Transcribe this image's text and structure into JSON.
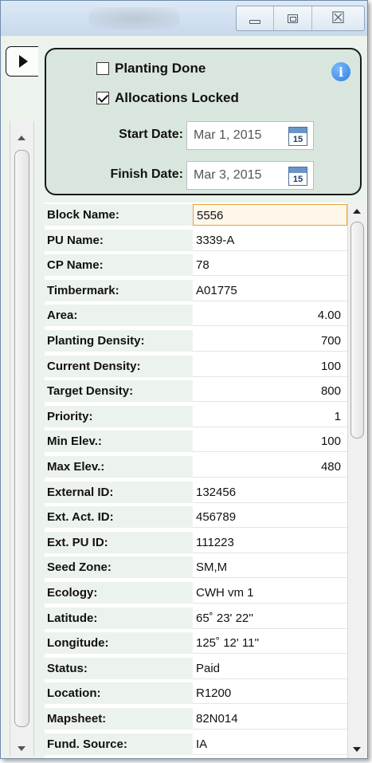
{
  "window": {
    "controls": {
      "minimize_icon": "minimize-icon",
      "maximize_icon": "restore-icon",
      "close_icon": "close-icon",
      "close_glyph": "☒"
    }
  },
  "panel": {
    "planting_done_label": "Planting Done",
    "planting_done_checked": false,
    "allocations_locked_label": "Allocations Locked",
    "allocations_locked_checked": true,
    "info_glyph": "i",
    "start_date_label": "Start Date:",
    "start_date_value": "Mar 1, 2015",
    "finish_date_label": "Finish Date:",
    "finish_date_value": "Mar 3, 2015",
    "calendar_day": "15"
  },
  "grid": {
    "rows": [
      {
        "label": "Block Name:",
        "value": "5556",
        "numeric": false,
        "selected": true
      },
      {
        "label": "PU Name:",
        "value": "3339-A",
        "numeric": false
      },
      {
        "label": "CP Name:",
        "value": "78",
        "numeric": false
      },
      {
        "label": "Timbermark:",
        "value": "A01775",
        "numeric": false
      },
      {
        "label": "Area:",
        "value": "4.00",
        "numeric": true
      },
      {
        "label": "Planting Density:",
        "value": "700",
        "numeric": true
      },
      {
        "label": "Current Density:",
        "value": "100",
        "numeric": true
      },
      {
        "label": "Target Density:",
        "value": "800",
        "numeric": true
      },
      {
        "label": "Priority:",
        "value": "1",
        "numeric": true
      },
      {
        "label": "Min Elev.:",
        "value": "100",
        "numeric": true
      },
      {
        "label": "Max Elev.:",
        "value": "480",
        "numeric": true
      },
      {
        "label": "External ID:",
        "value": "132456",
        "numeric": false
      },
      {
        "label": "Ext. Act. ID:",
        "value": "456789",
        "numeric": false
      },
      {
        "label": "Ext. PU ID:",
        "value": "111223",
        "numeric": false
      },
      {
        "label": "Seed Zone:",
        "value": "SM,M",
        "numeric": false
      },
      {
        "label": "Ecology:",
        "value": "CWH vm 1",
        "numeric": false
      },
      {
        "label": "Latitude:",
        "value": "65˚ 23' 22''",
        "numeric": false
      },
      {
        "label": "Longitude:",
        "value": "125˚ 12' 11''",
        "numeric": false
      },
      {
        "label": "Status:",
        "value": "Paid",
        "numeric": false
      },
      {
        "label": "Location:",
        "value": "R1200",
        "numeric": false
      },
      {
        "label": "Mapsheet:",
        "value": "82N014",
        "numeric": false
      },
      {
        "label": "Fund. Source:",
        "value": "IA",
        "numeric": false
      }
    ]
  }
}
